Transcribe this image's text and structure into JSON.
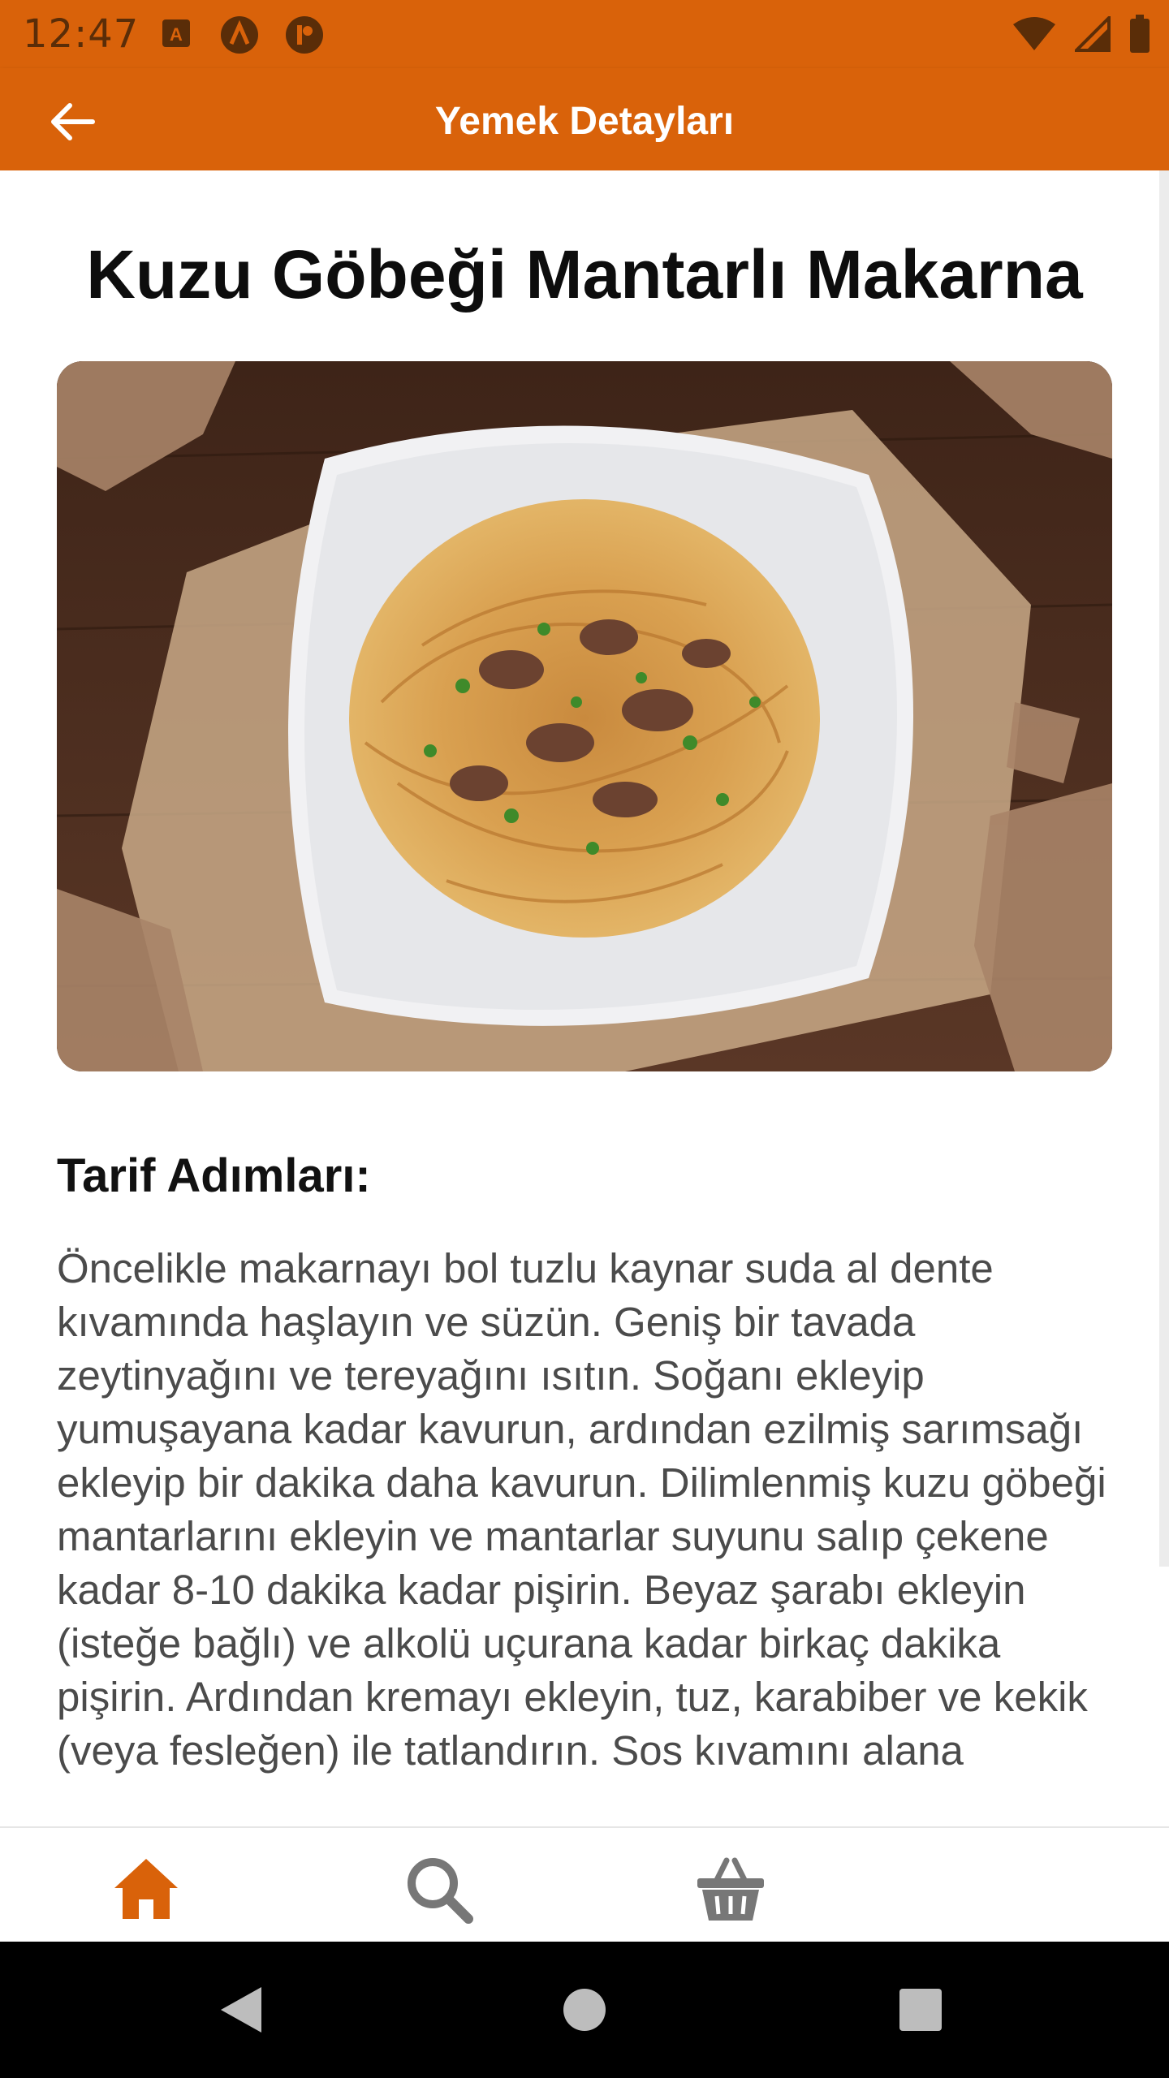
{
  "status_bar": {
    "time": "12:47",
    "left_icons": [
      "keyboard-icon",
      "a-circle-icon",
      "p-circle-icon"
    ],
    "right_icons": [
      "wifi-icon",
      "signal-icon",
      "battery-icon"
    ]
  },
  "app_bar": {
    "title": "Yemek Detayları",
    "back_icon": "arrow-left-icon",
    "background_color": "#d9620a"
  },
  "dish": {
    "title": "Kuzu Göbeği Mantarlı Makarna",
    "image_alt": "mushroom-pasta-photo"
  },
  "recipe": {
    "heading": "Tarif Adımları:",
    "text": "Öncelikle makarnayı bol tuzlu kaynar suda al dente kıvamında haşlayın ve süzün. Geniş bir tavada zeytinyağını ve tereyağını ısıtın. Soğanı ekleyip yumuşayana kadar kavurun, ardından ezilmiş sarımsağı ekleyip bir dakika daha kavurun. Dilimlenmiş kuzu göbeği mantarlarını ekleyin ve mantarlar suyunu salıp çekene kadar 8-10 dakika kadar pişirin. Beyaz şarabı ekleyin (isteğe bağlı) ve alkolü uçurana kadar birkaç dakika pişirin. Ardından kremayı ekleyin, tuz, karabiber ve kekik (veya fesleğen) ile tatlandırın. Sos kıvamını alana"
  },
  "bottom_nav": {
    "items": [
      {
        "icon": "home-icon",
        "active": true
      },
      {
        "icon": "search-icon",
        "active": false
      },
      {
        "icon": "basket-icon",
        "active": false
      }
    ],
    "active_color": "#d9620a",
    "inactive_color": "#777777"
  },
  "system_nav": {
    "buttons": [
      "back-triangle-icon",
      "home-circle-icon",
      "recents-square-icon"
    ]
  }
}
